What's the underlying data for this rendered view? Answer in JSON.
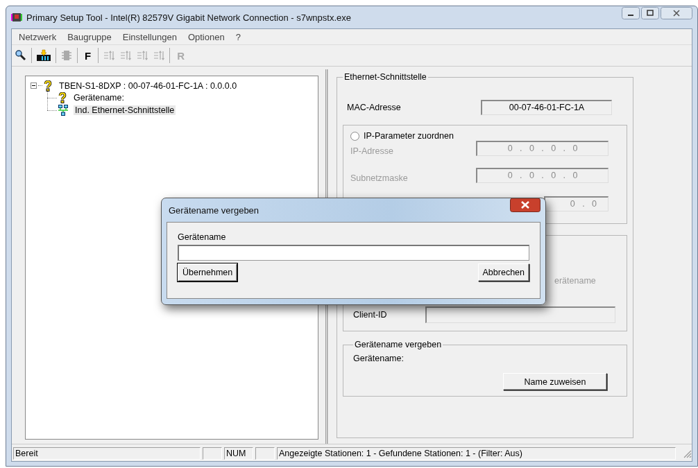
{
  "window": {
    "title": "Primary Setup Tool - Intel(R) 82579V Gigabit Network Connection - s7wnpstx.exe"
  },
  "menu": [
    {
      "label": "Netzwerk"
    },
    {
      "label": "Baugruppe"
    },
    {
      "label": "Einstellungen"
    },
    {
      "label": "Optionen"
    },
    {
      "label": "?"
    }
  ],
  "toolbar": {
    "buttons": [
      {
        "label": "F",
        "disabled": false
      },
      {
        "label": "R",
        "disabled": true
      }
    ]
  },
  "tree": {
    "label": "TBEN-S1-8DXP : 00-07-46-01-FC-1A : 0.0.0.0",
    "expanded": true,
    "selected": false,
    "children": [
      {
        "label": "Gerätename:",
        "kind": "unknown",
        "selected": false
      },
      {
        "label": "Ind. Ethernet-Schnittstelle",
        "kind": "network",
        "selected": true
      }
    ]
  },
  "ethernet": {
    "title": "Ethernet-Schnittstelle",
    "mac_label": "MAC-Adresse",
    "mac_value": "00-07-46-01-FC-1A",
    "ip_group": {
      "radio": {
        "label": "IP-Parameter zuordnen",
        "checked": false
      },
      "fields": [
        {
          "label": "IP-Adresse",
          "value": "0   .   0   .   0   .   0",
          "disabled": true
        },
        {
          "label": "Subnetzmaske",
          "value": "0   .   0   .   0   .   0",
          "disabled": true
        },
        {
          "value": "0   .   0",
          "disabled": true
        }
      ]
    },
    "name_group": {
      "option_label": "erätename",
      "disabled": true,
      "client_label": "Client-ID"
    },
    "assign_group": {
      "title": "Gerätename vergeben",
      "label": "Gerätename:",
      "button": {
        "label": "Name zuweisen"
      }
    }
  },
  "status_bar": {
    "message": "Bereit",
    "num": "NUM",
    "stations": "Angezeigte Stationen: 1 - Gefundene Stationen: 1 - (Filter: Aus)"
  },
  "dialog": {
    "title": "Gerätename vergeben",
    "field_label": "Gerätename",
    "buttons": [
      {
        "label": "Übernehmen",
        "default": true
      },
      {
        "label": "Abbrechen",
        "default": false
      }
    ]
  }
}
